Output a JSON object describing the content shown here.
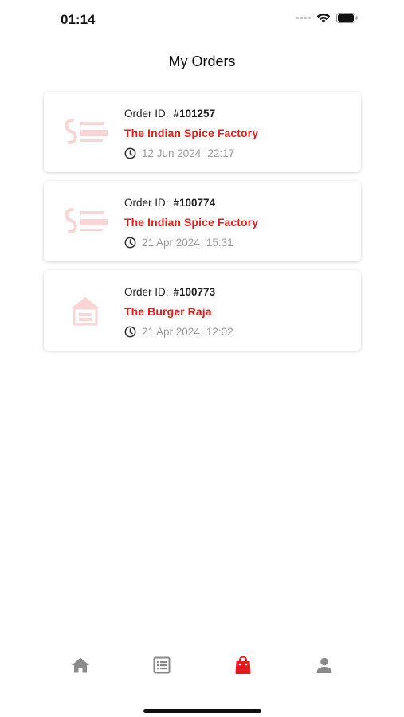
{
  "status_bar": {
    "time": "01:14"
  },
  "header": {
    "title": "My Orders"
  },
  "orders": [
    {
      "id_label": "Order ID:",
      "id": "#101257",
      "restaurant": "The Indian Spice Factory",
      "date": "12 Jun 2024",
      "time": "22:17",
      "logo": "indian-spice-factory-logo"
    },
    {
      "id_label": "Order ID:",
      "id": "#100774",
      "restaurant": "The Indian Spice Factory",
      "date": "21 Apr 2024",
      "time": "15:31",
      "logo": "indian-spice-factory-logo"
    },
    {
      "id_label": "Order ID:",
      "id": "#100773",
      "restaurant": "The Burger Raja",
      "date": "21 Apr 2024",
      "time": "12:02",
      "logo": "burger-raja-logo"
    }
  ],
  "bottom_nav": {
    "items": [
      {
        "icon": "home-icon",
        "active": false
      },
      {
        "icon": "menu-list-icon",
        "active": false
      },
      {
        "icon": "shopping-bag-icon",
        "active": true
      },
      {
        "icon": "profile-icon",
        "active": false
      }
    ],
    "active_color": "#e51b1b",
    "inactive_color": "#8a8a8a"
  },
  "colors": {
    "accent": "#e51b1b",
    "muted_text": "#9a9a9a"
  }
}
